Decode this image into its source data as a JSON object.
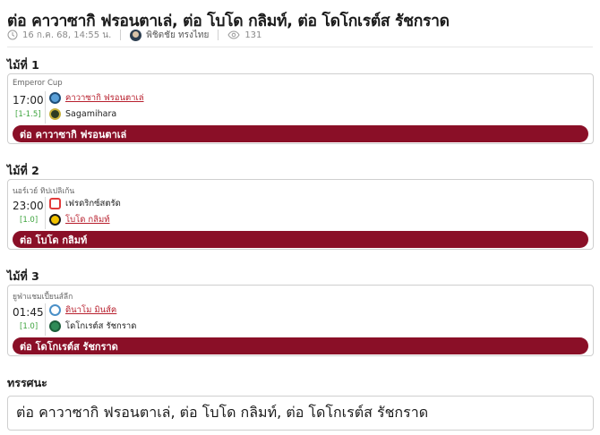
{
  "article": {
    "title": "ต่อ คาวาซากิ ฟรอนตาเล่, ต่อ โบโด กลิมท์, ต่อ โดโกเรต์ส รัชกราด",
    "date": "16 ก.ค. 68, 14:55 น.",
    "author": "พิชิตชัย ทรงไทย",
    "views": "131",
    "icons": {
      "date": "clock-icon",
      "views": "eye-icon"
    }
  },
  "pairs": [
    {
      "heading": "ไม้ที่ 1",
      "league": "Emperor Cup",
      "time": "17:00",
      "odds": "[1-1.5]",
      "home": {
        "name": "คาวาซากิ ฟรอนตาเล่",
        "favorite": true,
        "logo_color": "#5aa0d8"
      },
      "away": {
        "name": "Sagamihara",
        "favorite": false,
        "logo_color": "#2d3b22"
      },
      "pick": "ต่อ คาวาซากิ ฟรอนตาเล่"
    },
    {
      "heading": "ไม้ที่ 2",
      "league": "นอร์เวย์ ทิปเปลิเก้น",
      "time": "23:00",
      "odds": "[1.0]",
      "home": {
        "name": "เฟรดริกซ์สตรัด",
        "favorite": false,
        "logo_color": "#e23b3b"
      },
      "away": {
        "name": "โบโด กลิมท์",
        "favorite": true,
        "logo_color": "#f2c300"
      },
      "pick": "ต่อ โบโด กลิมท์"
    },
    {
      "heading": "ไม้ที่ 3",
      "league": "ยูฟ่าแชมเปี้ยนส์ลีก",
      "time": "01:45",
      "odds": "[1.0]",
      "home": {
        "name": "ดินาโม มินส์ค",
        "favorite": true,
        "logo_color": "#4a90c8"
      },
      "away": {
        "name": "โดโกเรต์ส รัชกราด",
        "favorite": false,
        "logo_color": "#2e8b57"
      },
      "pick": "ต่อ โดโกเรต์ส รัชกราด"
    }
  ],
  "summary": {
    "heading": "ทรรศนะ",
    "text": "ต่อ คาวาซากิ ฟรอนตาเล่, ต่อ โบโด กลิมท์, ต่อ โดโกเรต์ส รัชกราด"
  },
  "colors": {
    "accent": "#8a0f27",
    "odds": "#3da33d",
    "favorite_link": "#b8202e"
  }
}
